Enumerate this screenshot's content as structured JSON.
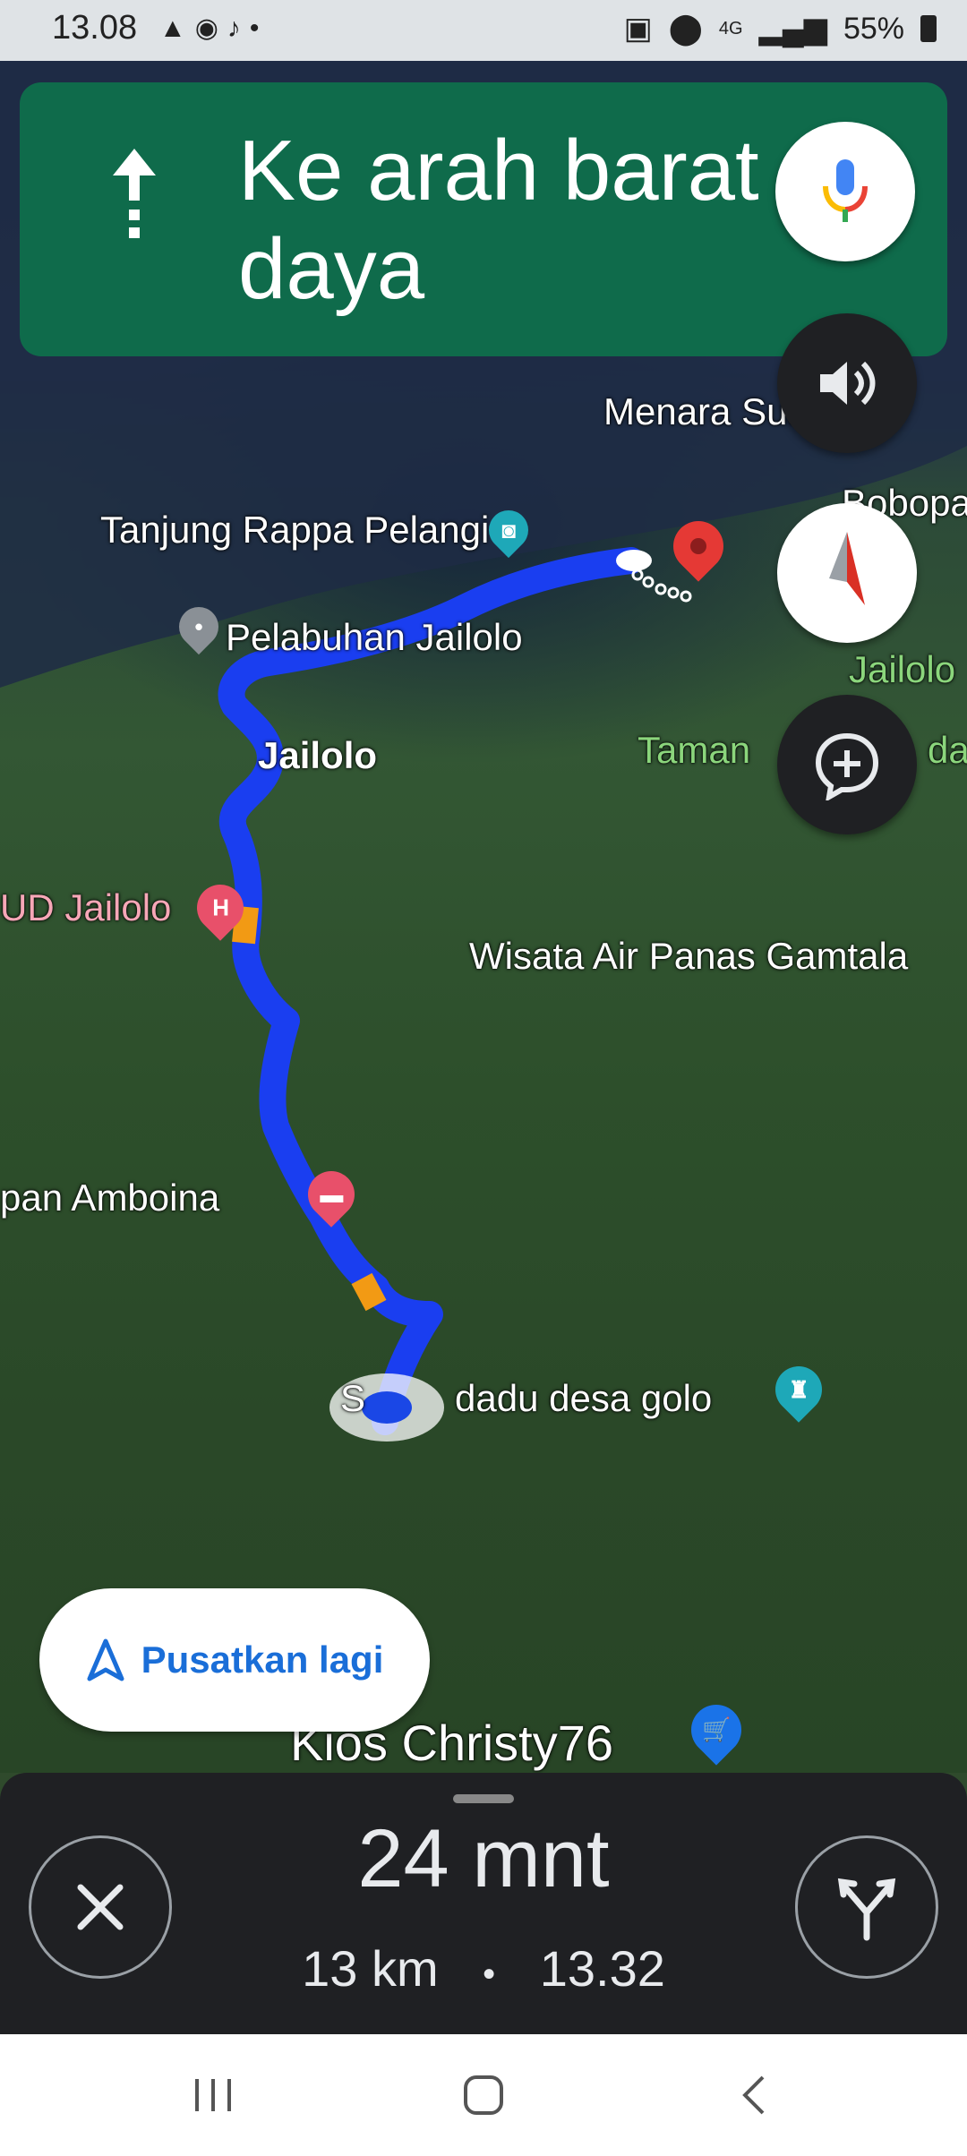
{
  "status_bar": {
    "time": "13.08",
    "network": "4G",
    "battery": "55%"
  },
  "banner": {
    "direction_text": "Ke arah barat daya",
    "arrow_icon": "straight-arrow-icon",
    "mic_icon": "google-mic-icon"
  },
  "map": {
    "places": [
      {
        "id": "menara",
        "label": "Menara Sua"
      },
      {
        "id": "bobopa",
        "label": "Bobopa"
      },
      {
        "id": "tanjung",
        "label": "Tanjung Rappa Pelangi"
      },
      {
        "id": "pelabuhan",
        "label": "Pelabuhan Jailolo"
      },
      {
        "id": "jailolo_green",
        "label": "Jailolo"
      },
      {
        "id": "taman",
        "label": "Taman"
      },
      {
        "id": "taman2",
        "label": "dar"
      },
      {
        "id": "jailolo_town",
        "label": "Jailolo"
      },
      {
        "id": "rsud",
        "label": "UD Jailolo"
      },
      {
        "id": "wisata",
        "label": "Wisata Air Panas Gamtala"
      },
      {
        "id": "amboina",
        "label": "pan Amboina"
      },
      {
        "id": "golo",
        "label": "dadu desa golo"
      },
      {
        "id": "golo_prefix",
        "label": "S"
      },
      {
        "id": "kios",
        "label": "Kios Christy76"
      }
    ],
    "colors": {
      "route": "#1a3ef0",
      "traffic": "#f29a14",
      "destination": "#e53935"
    }
  },
  "controls": {
    "recenter_label": "Pusatkan lagi"
  },
  "trip": {
    "eta": "24 mnt",
    "distance": "13 km",
    "separator": "•",
    "arrival": "13.32"
  },
  "nav_bar": {
    "items": [
      "recent-apps-icon",
      "home-icon",
      "back-icon"
    ]
  }
}
